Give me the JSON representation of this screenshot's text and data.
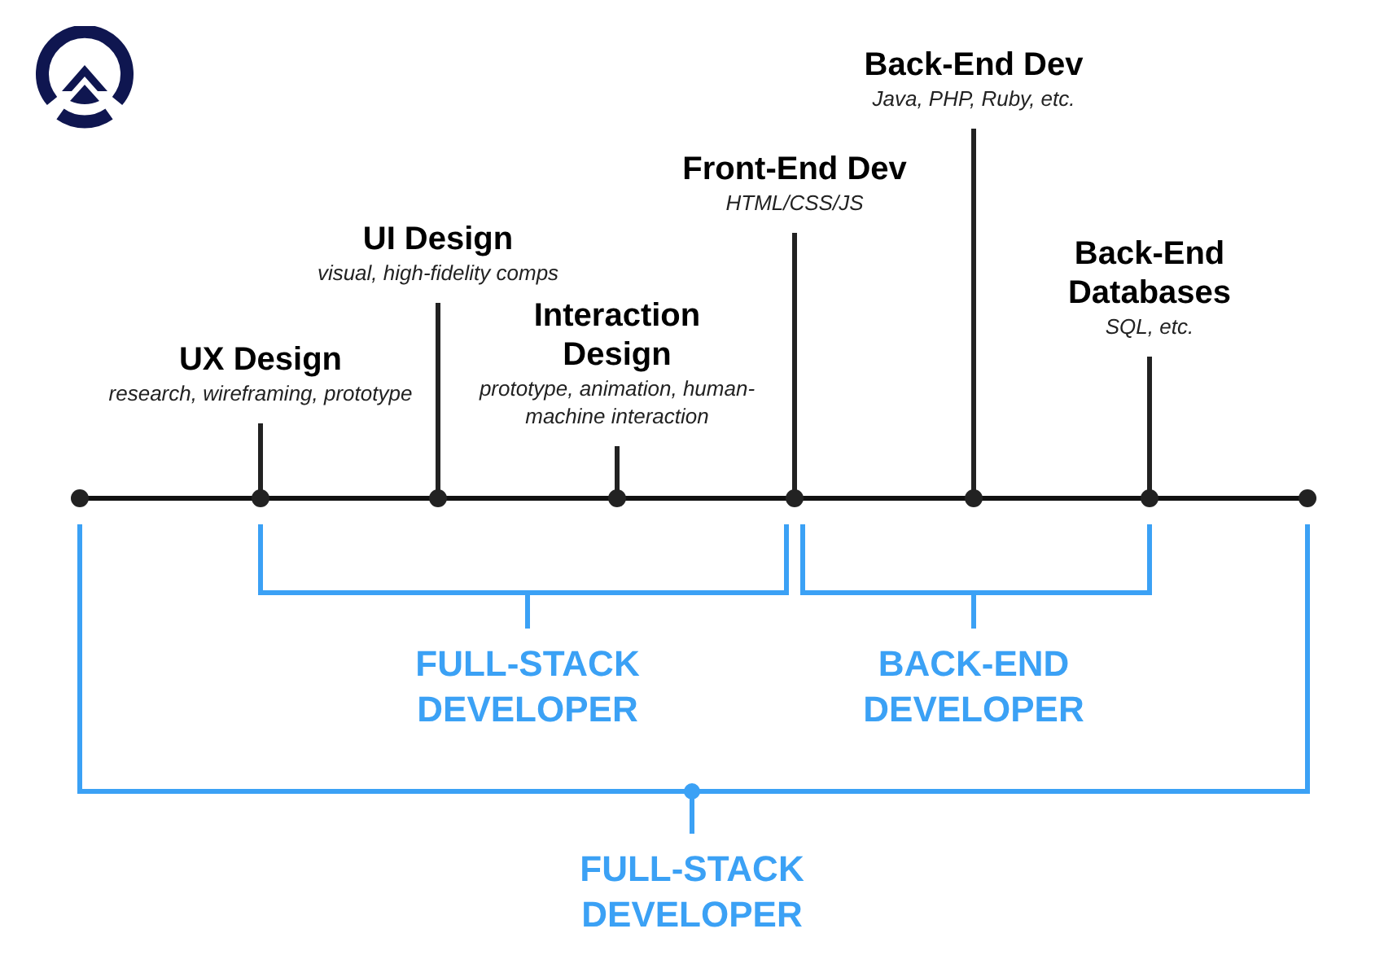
{
  "stages": [
    {
      "title": "UX Design",
      "subtitle": "research, wireframing, prototype"
    },
    {
      "title": "UI Design",
      "subtitle": "visual, high-fidelity comps"
    },
    {
      "title": "Interaction Design",
      "subtitle": "prototype, animation, human-machine interaction"
    },
    {
      "title": "Front-End Dev",
      "subtitle": "HTML/CSS/JS"
    },
    {
      "title": "Back-End Dev",
      "subtitle": "Java, PHP, Ruby, etc."
    },
    {
      "title": "Back-End Databases",
      "subtitle": "SQL, etc."
    }
  ],
  "brackets": [
    {
      "label": "FULL-STACK DEVELOPER"
    },
    {
      "label": "BACK-END DEVELOPER"
    },
    {
      "label": "FULL-STACK DEVELOPER"
    }
  ]
}
